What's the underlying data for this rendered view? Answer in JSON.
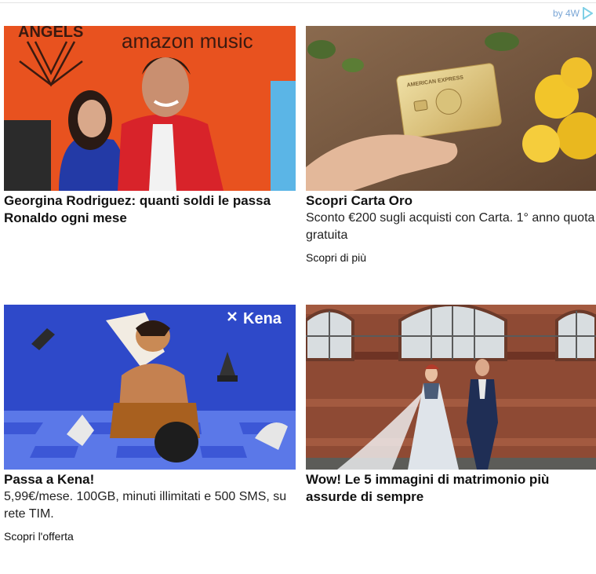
{
  "provider": {
    "label": "by 4W",
    "icon": "play-triangle-icon"
  },
  "cards": [
    {
      "title": "Georgina Rodriguez: quanti soldi le passa Ronaldo ogni mese",
      "image_text": {
        "left_logo": "ANGELS",
        "right_logo": "amazon music"
      }
    },
    {
      "title": "Scopri Carta Oro",
      "description": "Sconto €200 sugli acquisti con Carta. 1° anno quota gratuita",
      "cta": "Scopri di più",
      "image_text": {
        "card_brand": "AMERICAN EXPRESS"
      }
    },
    {
      "title": "Passa a Kena!",
      "description": "5,99€/mese. 100GB, minuti illimitati e 500 SMS, su rete TIM.",
      "cta": "Scopri l'offerta",
      "image_text": {
        "brand": "Kena"
      }
    },
    {
      "title": "Wow! Le 5 immagini di matrimonio più assurde di sempre"
    }
  ],
  "colors": {
    "red_carpet": "#e8521f",
    "kena_blue": "#2e49c9",
    "provider_blue": "#7aa6d6"
  }
}
